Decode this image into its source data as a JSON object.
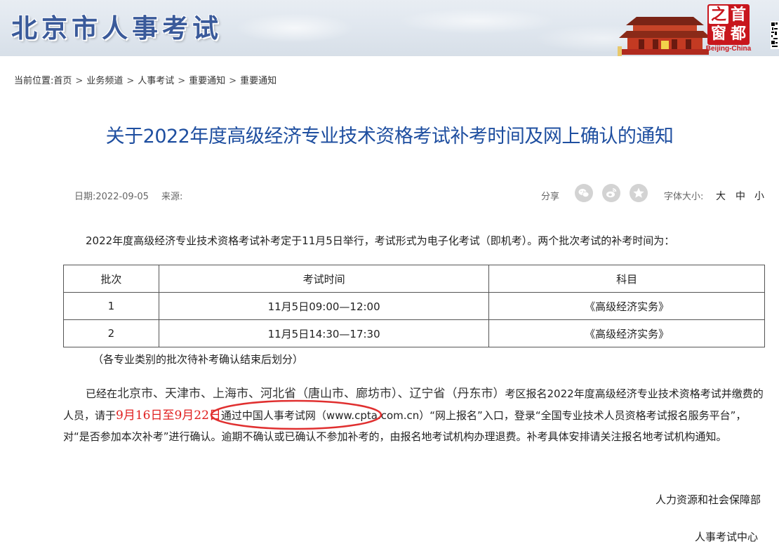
{
  "header": {
    "site_title": "北京市人事考试",
    "seal_chars": [
      "首",
      "都",
      "之",
      "窗"
    ],
    "seal_caption": "Beijing-China",
    "icons": [
      "tiananmen-gate-icon",
      "qr-code-icon"
    ]
  },
  "breadcrumb": {
    "prefix": "当前位置:",
    "items": [
      "首页",
      "业务频道",
      "人事考试",
      "重要通知",
      "重要通知"
    ],
    "separator": ">"
  },
  "article": {
    "title": "关于2022年度高级经济专业技术资格考试补考时间及网上确认的通知",
    "date_label": "日期:",
    "date": "2022-09-05",
    "source_label": "来源:",
    "share_label": "分享",
    "share_icons": [
      "wechat-icon",
      "weibo-icon",
      "favorite-star-icon"
    ],
    "font_size_label": "字体大小:",
    "font_sizes": [
      "大",
      "中",
      "小"
    ],
    "intro": "2022年度高级经济专业技术资格考试补考定于11月5日举行，考试形式为电子化考试（即机考）。两个批次考试的补考时间为：",
    "table": {
      "headers": [
        "批次",
        "考试时间",
        "科目"
      ],
      "rows": [
        [
          "1",
          "11月5日09:00—12:00",
          "《高级经济实务》"
        ],
        [
          "2",
          "11月5日14:30—17:30",
          "《高级经济实务》"
        ]
      ]
    },
    "note": "（各专业类别的批次待补考确认结束后划分）",
    "body": {
      "lead": "已经在",
      "regions": "北京市、天津市、上海市、河北省（唐山市、廊坊市）、辽宁省（丹东市）",
      "mid1": "考区报名2022年度高级经济专业技术资格考试并缴费的人员，请于",
      "date_start": "9月16日",
      "date_to": "至",
      "date_end": "9月22日",
      "rest": "通过中国人事考试网（www.cpta.com.cn）“网上报名”入口，登录“全国专业技术人员资格考试报名服务平台”，对“是否参加本次补考”进行确认。逾期不确认或已确认不参加补考的，由报名地考试机构办理退费。补考具体安排请关注报名地考试机构通知。"
    },
    "signature_1": "人力资源和社会保障部",
    "signature_2": "人事考试中心"
  },
  "colors": {
    "title_blue": "#1f4fa0",
    "site_title_blue": "#3a5a9a",
    "highlight_red": "#e02020",
    "seal_red": "#c8161d"
  }
}
